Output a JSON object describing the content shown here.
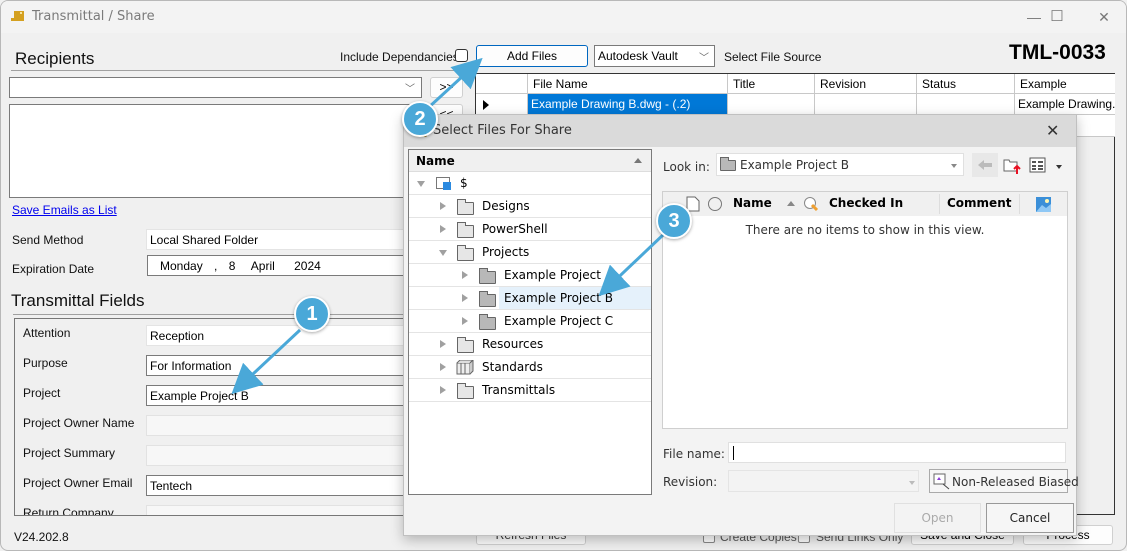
{
  "window": {
    "title": "Transmittal / Share",
    "minimize_label": "—",
    "maximize_label": "☐",
    "close_label": "✕"
  },
  "recipients": {
    "heading": "Recipients",
    "combo_value": "",
    "add_button": ">>",
    "remove_button": "<<",
    "save_link": "Save Emails as List"
  },
  "toolbar": {
    "include_dependancies_label": "Include Dependancies",
    "include_dependancies_checked": false,
    "add_files_label": "Add Files",
    "source_value": "Autodesk Vault",
    "source_caption": "Select File Source",
    "transmittal_id": "TML-0033"
  },
  "files_grid": {
    "columns": [
      "File Name",
      "Title",
      "Revision",
      "Status",
      "Example"
    ],
    "rows": [
      {
        "file_name": "Example Drawing B.dwg - (.2)",
        "title": "",
        "revision": "",
        "status": "",
        "example": "Example Drawing..."
      }
    ]
  },
  "send": {
    "method_label": "Send Method",
    "method_value": "Local Shared Folder",
    "expiration_label": "Expiration Date",
    "expiration_weekday": "Monday",
    "expiration_sep": ",",
    "expiration_day": "8",
    "expiration_month": "April",
    "expiration_year": "2024"
  },
  "transmittal_fields": {
    "heading": "Transmittal Fields",
    "fields": [
      {
        "label": "Attention",
        "value": "Reception",
        "editable": true
      },
      {
        "label": "Purpose",
        "value": "For Information",
        "editable": true
      },
      {
        "label": "Project",
        "value": "Example Project B",
        "editable": true
      },
      {
        "label": "Project Owner Name",
        "value": "",
        "editable": false
      },
      {
        "label": "Project Summary",
        "value": "",
        "editable": false
      },
      {
        "label": "Project Owner Email",
        "value": "Tentech",
        "editable": true
      },
      {
        "label": "Return Company",
        "value": "",
        "editable": false
      }
    ]
  },
  "footer": {
    "version": "V24.202.8",
    "refresh_files": "Refresh Files",
    "create_copies": "Create Copies",
    "send_links_only": "Send Links Only",
    "save_and_close": "Save and Close",
    "process": "Process"
  },
  "dialog": {
    "title": "Select Files For Share",
    "close_label": "✕",
    "tree_header": "Name",
    "tree": [
      {
        "label": "$",
        "level": 0,
        "expanded": true,
        "icon": "vault-root-icon"
      },
      {
        "label": "Designs",
        "level": 1,
        "expanded": false,
        "icon": "folder-icon"
      },
      {
        "label": "PowerShell",
        "level": 1,
        "expanded": false,
        "icon": "folder-icon"
      },
      {
        "label": "Projects",
        "level": 1,
        "expanded": true,
        "icon": "folder-icon"
      },
      {
        "label": "Example Project",
        "level": 2,
        "expanded": false,
        "icon": "project-folder-icon"
      },
      {
        "label": "Example Project B",
        "level": 2,
        "expanded": false,
        "icon": "project-folder-icon",
        "selected": true
      },
      {
        "label": "Example Project C",
        "level": 2,
        "expanded": false,
        "icon": "project-folder-icon"
      },
      {
        "label": "Resources",
        "level": 1,
        "expanded": false,
        "icon": "folder-icon"
      },
      {
        "label": "Standards",
        "level": 1,
        "expanded": false,
        "icon": "library-folder-icon"
      },
      {
        "label": "Transmittals",
        "level": 1,
        "expanded": false,
        "icon": "folder-icon"
      }
    ],
    "look_in_label": "Look in:",
    "look_in_value": "Example Project B",
    "list_columns": [
      "Name",
      "Checked In",
      "Comment"
    ],
    "empty_message": "There are no items to show in this view.",
    "file_name_label": "File name:",
    "file_name_value": "",
    "revision_label": "Revision:",
    "revision_value": "",
    "non_released_label": "Non-Released Biased",
    "open_label": "Open",
    "cancel_label": "Cancel"
  },
  "callouts": [
    "1",
    "2",
    "3"
  ],
  "colors": {
    "selection": "#0078d7",
    "callout": "#4aa8d8",
    "tree_selected": "#e5f1fb"
  }
}
